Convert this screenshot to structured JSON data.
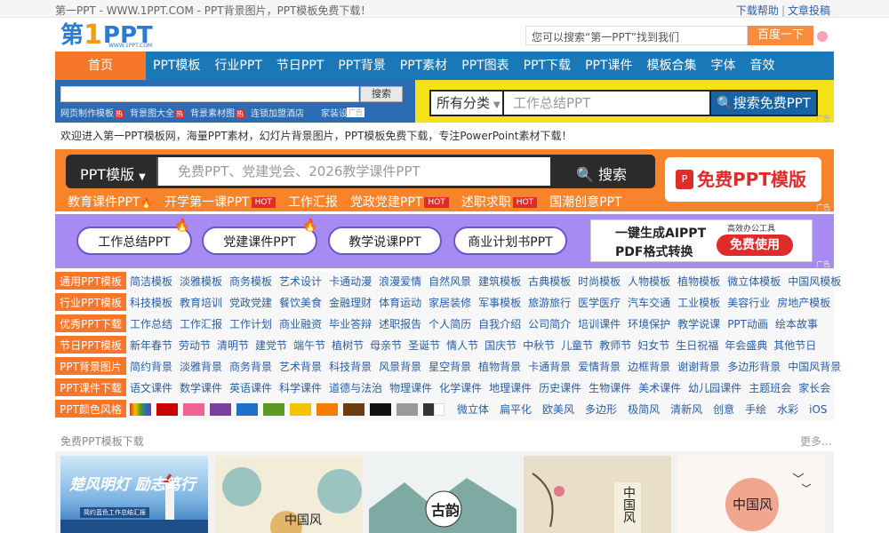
{
  "topbar": {
    "site_text": "第一PPT - WWW.1PPT.COM - PPT背景图片，PPT模板免费下载！",
    "help_link": "下载帮助",
    "separator": "|",
    "submit_link": "文章投稿"
  },
  "logo": {
    "part1": "第",
    "part2": "1",
    "part3": "PPT",
    "sub": "WWW.1PPT.COM"
  },
  "header_search": {
    "placeholder": "您可以搜索“第一PPT”找到我们",
    "button": "百度一下"
  },
  "nav": [
    "首页",
    "PPT模板",
    "行业PPT",
    "节日PPT",
    "PPT背景",
    "PPT素材",
    "PPT图表",
    "PPT下载",
    "PPT课件",
    "模板合集",
    "字体",
    "音效"
  ],
  "search_left": {
    "button": "搜索",
    "links": [
      {
        "text": "网页制作模板",
        "hot": "热"
      },
      {
        "text": "背景图大全",
        "hot": "热"
      },
      {
        "text": "背景素材图",
        "hot": "热"
      },
      {
        "text": "连锁加盟酒店",
        "hot": ""
      },
      {
        "text": "家装设计",
        "hot": ""
      }
    ],
    "ad": "广告"
  },
  "search_right": {
    "category": "所有分类",
    "placeholder": "工作总结PPT",
    "button": "搜索免费PPT",
    "ad": "广告"
  },
  "welcome": "欢迎进入第一PPT模板网，海量PPT素材，幻灯片背景图片，PPT模板免费下载，专注PowerPoint素材下载！",
  "banner1": {
    "label": "PPT模版",
    "placeholder": "免费PPT、党建党会、2026教学课件PPT",
    "button": "搜索",
    "free_button": "免费PPT模版",
    "pdf_icon": "P",
    "links": [
      {
        "text": "教育课件PPT",
        "tag": "🔥"
      },
      {
        "text": "开学第一课PPT",
        "tag": "HOT"
      },
      {
        "text": "工作汇报",
        "tag": ""
      },
      {
        "text": "党政党建PPT",
        "tag": "HOT"
      },
      {
        "text": "述职求职",
        "tag": "HOT"
      },
      {
        "text": "国潮创意PPT",
        "tag": ""
      }
    ],
    "ad": "广告"
  },
  "banner2": {
    "pills": [
      "工作总结PPT",
      "党建课件PPT",
      "教学说课PPT",
      "商业计划书PPT"
    ],
    "ai_line1": "一键生成AIPPT",
    "ai_line2": "PDF格式转换",
    "ai_tag": "高效办公工具",
    "ai_button": "免费使用",
    "ad": "广告"
  },
  "categories": [
    {
      "label": "通用PPT模板",
      "items": [
        "简洁模板",
        "淡雅模板",
        "商务模板",
        "艺术设计",
        "卡通动漫",
        "浪漫爱情",
        "自然风景",
        "建筑模板",
        "古典模板",
        "时尚模板",
        "人物模板",
        "植物模板",
        "微立体模板",
        "中国风模板"
      ]
    },
    {
      "label": "行业PPT模板",
      "items": [
        "科技模板",
        "教育培训",
        "党政党建",
        "餐饮美食",
        "金融理财",
        "体育运动",
        "家居装修",
        "军事模板",
        "旅游旅行",
        "医学医疗",
        "汽车交通",
        "工业模板",
        "美容行业",
        "房地产模板"
      ]
    },
    {
      "label": "优秀PPT下载",
      "items": [
        "工作总结",
        "工作汇报",
        "工作计划",
        "商业融资",
        "毕业答辩",
        "述职报告",
        "个人简历",
        "自我介绍",
        "公司简介",
        "培训课件",
        "环境保护",
        "教学说课",
        "PPT动画",
        "绘本故事"
      ]
    },
    {
      "label": "节日PPT模板",
      "items": [
        "新年春节",
        "劳动节",
        "清明节",
        "建党节",
        "端午节",
        "植树节",
        "母亲节",
        "圣诞节",
        "情人节",
        "国庆节",
        "中秋节",
        "儿童节",
        "教师节",
        "妇女节",
        "生日祝福",
        "年会盛典",
        "其他节日"
      ]
    },
    {
      "label": "PPT背景图片",
      "items": [
        "简约背景",
        "淡雅背景",
        "商务背景",
        "艺术背景",
        "科技背景",
        "风景背景",
        "星空背景",
        "植物背景",
        "卡通背景",
        "爱情背景",
        "边框背景",
        "谢谢背景",
        "多边形背景",
        "中国风背景"
      ]
    },
    {
      "label": "PPT课件下载",
      "items": [
        "语文课件",
        "数学课件",
        "英语课件",
        "科学课件",
        "道德与法治",
        "物理课件",
        "化学课件",
        "地理课件",
        "历史课件",
        "生物课件",
        "美术课件",
        "幼儿园课件",
        "主题班会",
        "家长会"
      ]
    },
    {
      "label": "PPT颜色风格",
      "items": [
        "微立体",
        "扁平化",
        "欧美风",
        "多边形",
        "极简风",
        "清新风",
        "创意",
        "手绘",
        "水彩",
        "iOS"
      ]
    }
  ],
  "swatch_colors": [
    "#e8301c",
    "#cc0000",
    "#f06292",
    "#7b3fa0",
    "#1f6fc8",
    "#5b9a1e",
    "#f5c400",
    "#f57c00",
    "#6d3b12",
    "#111111",
    "#999999",
    "#333333"
  ],
  "free_section": {
    "title": "免费PPT模板下载",
    "more": "更多..."
  },
  "cards": [
    {
      "title": "楚风明灯 励志笃行",
      "subtitle": "简约蓝色工作总结汇报"
    },
    {
      "title": "中国风"
    },
    {
      "title": "古韵"
    },
    {
      "title": "中国风"
    },
    {
      "title": "中国风"
    }
  ]
}
